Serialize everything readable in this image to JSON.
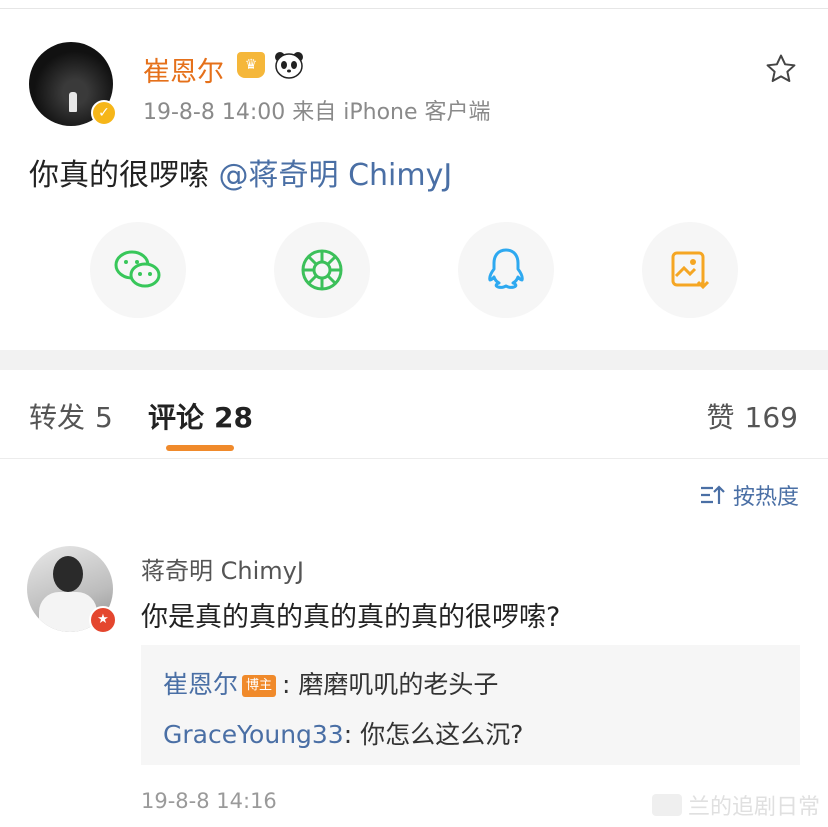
{
  "post": {
    "author": "崔恩尔",
    "crown_badge_icon": "crown-icon",
    "panda_badge_icon": "panda-icon",
    "verified_icon": "verified-v-icon",
    "meta": "19-8-8 14:00  来自 iPhone 客户端",
    "text": "你真的很啰嗦 ",
    "mention": "@蒋奇明 ChimyJ"
  },
  "share": [
    {
      "name": "wechat",
      "icon": "wechat-icon",
      "color": "#38c75a"
    },
    {
      "name": "moments",
      "icon": "moments-icon",
      "color": "#3cc05a"
    },
    {
      "name": "qq",
      "icon": "qq-icon",
      "color": "#2ea9f0"
    },
    {
      "name": "save-image",
      "icon": "save-image-icon",
      "color": "#f5a623"
    }
  ],
  "tabs": {
    "repost_label": "转发",
    "repost_count": "5",
    "comment_label": "评论",
    "comment_count": "28",
    "like_label": "赞",
    "like_count": "169"
  },
  "sort_label": "按热度",
  "comment": {
    "author": "蒋奇明 ChimyJ",
    "text": "你是真的真的真的真的真的很啰嗦?",
    "replies": [
      {
        "who": "崔恩尔",
        "tag": "博主",
        "text": ": 磨磨叽叽的老头子"
      },
      {
        "who": "GraceYoung33",
        "text": ": 你怎么这么沉?"
      }
    ],
    "time": "19-8-8 14:16"
  },
  "watermark": "兰的追剧日常",
  "colors": {
    "accent": "#f08a2b",
    "link": "#4a6fa5",
    "author": "#e5701a"
  }
}
